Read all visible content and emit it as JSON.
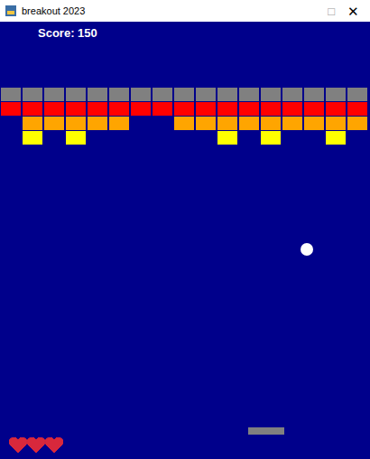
{
  "window": {
    "title": "breakout 2023",
    "buttons": [
      "□",
      "✕"
    ]
  },
  "score": "Score: 150",
  "bricks": [
    {
      "color": "#808080",
      "cells": [
        true,
        true,
        true,
        true,
        true,
        true,
        true,
        true,
        true,
        true,
        true,
        true,
        true,
        true,
        true,
        true,
        true
      ]
    },
    {
      "color": "#ff0000",
      "cells": [
        true,
        true,
        true,
        true,
        true,
        true,
        true,
        true,
        true,
        true,
        true,
        true,
        true,
        true,
        true,
        true,
        true
      ]
    },
    {
      "color": "#ffa500",
      "cells": [
        false,
        true,
        true,
        true,
        true,
        true,
        false,
        false,
        true,
        true,
        true,
        true,
        true,
        true,
        true,
        true,
        true
      ]
    },
    {
      "color": "#ffff00",
      "cells": [
        false,
        true,
        false,
        true,
        false,
        false,
        false,
        false,
        false,
        false,
        true,
        false,
        true,
        false,
        false,
        true,
        false
      ]
    }
  ],
  "lives": [
    {
      "full": true
    },
    {
      "full": true
    },
    {
      "full": true
    }
  ]
}
